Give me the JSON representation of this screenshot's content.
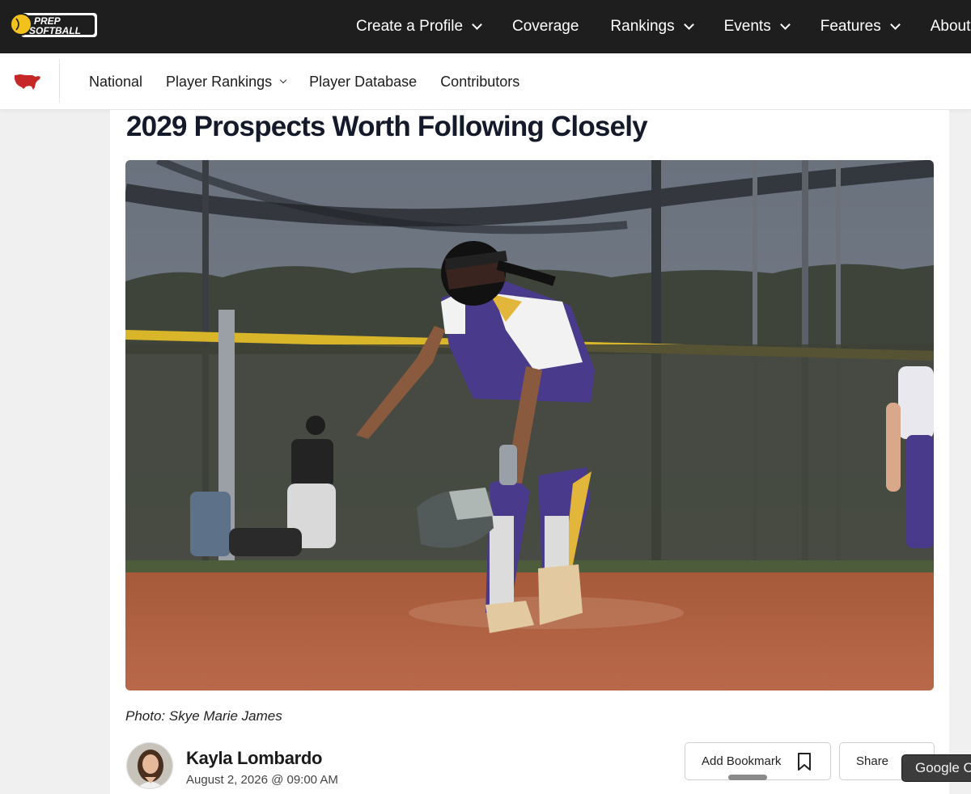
{
  "brand": {
    "logo_text_line1": "PREP",
    "logo_text_line2": "SOFTBALL"
  },
  "top_nav": [
    {
      "label": "Create a Profile",
      "has_dropdown": true
    },
    {
      "label": "Coverage",
      "has_dropdown": false
    },
    {
      "label": "Rankings",
      "has_dropdown": true
    },
    {
      "label": "Events",
      "has_dropdown": true
    },
    {
      "label": "Features",
      "has_dropdown": true
    },
    {
      "label": "About",
      "has_dropdown": false
    }
  ],
  "sub_nav": {
    "region_icon": "usa-map-icon",
    "items": [
      {
        "label": "National",
        "has_dropdown": false
      },
      {
        "label": "Player Rankings",
        "has_dropdown": true
      },
      {
        "label": "Player Database",
        "has_dropdown": false
      },
      {
        "label": "Contributors",
        "has_dropdown": false
      }
    ]
  },
  "article": {
    "title": "2029 Prospects Worth Following Closely",
    "photo_caption": "Photo: Skye Marie James",
    "author": {
      "name": "Kayla Lombardo",
      "date": "August 2, 2026 @ 09:00 AM"
    },
    "actions": {
      "bookmark_label": "Add Bookmark",
      "share_label": "Share"
    }
  },
  "tooltip": {
    "text": "Google C"
  },
  "colors": {
    "topbar": "#1e1e1e",
    "accent_yellow": "#f2c21a",
    "usa_red": "#c62828",
    "title": "#141a2a"
  }
}
